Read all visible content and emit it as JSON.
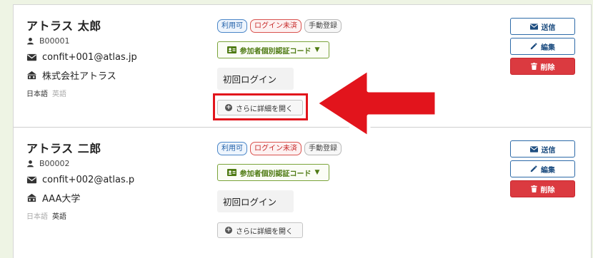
{
  "participants": [
    {
      "name": "アトラス 太郎",
      "id": "B00001",
      "email": "confit+001@atlas.jp",
      "org": "株式会社アトラス",
      "lang_ja": "日本語",
      "lang_en": "英語",
      "lang_active": "ja"
    },
    {
      "name": "アトラス 二郎",
      "id": "B00002",
      "email": "confit+002@atlas.p",
      "org": "AAA大学",
      "lang_ja": "日本語",
      "lang_en": "英語",
      "lang_active": "en"
    }
  ],
  "badges": {
    "available": "利用可",
    "not_logged_in": "ログイン未済",
    "manual": "手動登録"
  },
  "auth_code_label": "参加者個別認証コード",
  "first_login_label": "初回ログイン",
  "details_label": "さらに詳細を開く",
  "actions": {
    "send": "送信",
    "edit": "編集",
    "delete": "削除"
  },
  "colors": {
    "highlight": "#e2141c",
    "danger": "#db3a40",
    "primary": "#2d6aa8",
    "auth_green": "#7aa33a"
  },
  "icons": {
    "user": "user-icon",
    "mail": "envelope-icon",
    "org": "building-icon",
    "id_card": "id-card-icon",
    "pencil": "pencil-icon",
    "trash": "trash-icon",
    "plus": "plus-circle-icon"
  }
}
